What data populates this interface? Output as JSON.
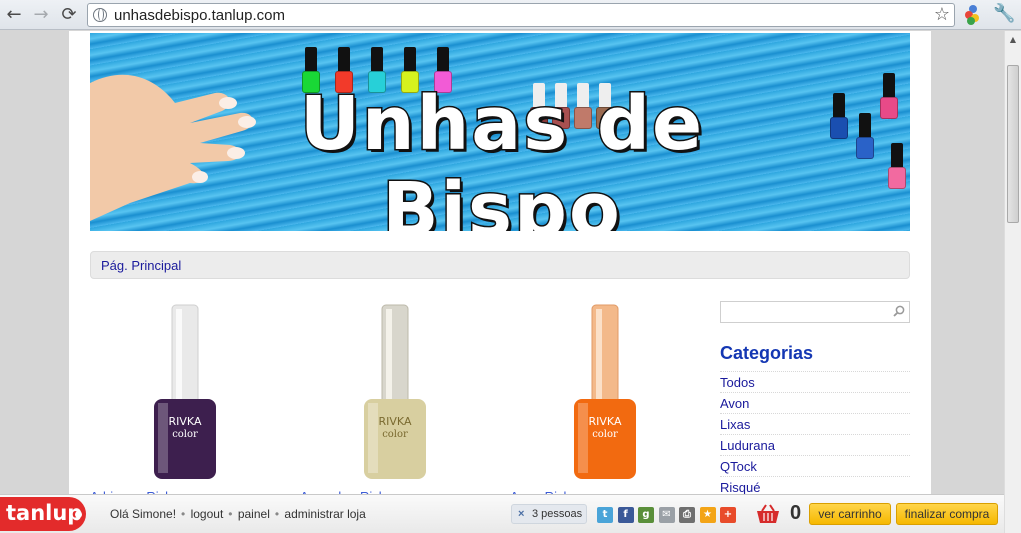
{
  "browser": {
    "url": "unhasdebispo.tanlup.com",
    "back_glyph": "←",
    "forward_glyph": "→",
    "reload_glyph": "⟳",
    "star_glyph": "☆",
    "wrench_glyph": "🔧"
  },
  "site": {
    "banner_title": "Unhas de Bispo",
    "nav": [
      "Pág. Principal"
    ]
  },
  "products": [
    {
      "name": "Adriana - Rivka",
      "color": "#3d1f4e",
      "icon": "nail-polish-bottle-icon"
    },
    {
      "name": "Amanda - Rivka",
      "color": "#d8cfa0",
      "icon": "nail-polish-bottle-icon"
    },
    {
      "name": "Ana - Rivka",
      "color": "#f26a10",
      "icon": "nail-polish-bottle-icon"
    }
  ],
  "sidebar": {
    "search_placeholder": "",
    "categories_title": "Categorias",
    "categories": [
      "Todos",
      "Avon",
      "Lixas",
      "Ludurana",
      "QTock",
      "Risqué"
    ]
  },
  "toolbar": {
    "logo": "tanlup",
    "greeting": "Olá Simone!",
    "links": [
      "logout",
      "painel",
      "administrar loja"
    ],
    "people_x": "×",
    "people": "3 pessoas",
    "cart_count": "0",
    "view_cart": "ver carrinho",
    "checkout": "finalizar compra",
    "share_icons": [
      {
        "name": "twitter-icon",
        "color": "#4aa4d8",
        "glyph": "t"
      },
      {
        "name": "facebook-icon",
        "color": "#3b5998",
        "glyph": "f"
      },
      {
        "name": "google-icon",
        "color": "#5a8f3a",
        "glyph": "g"
      },
      {
        "name": "email-icon",
        "color": "#9aa0a6",
        "glyph": "✉"
      },
      {
        "name": "print-icon",
        "color": "#6f6f6f",
        "glyph": "⎙"
      },
      {
        "name": "favorite-icon",
        "color": "#f3a416",
        "glyph": "★"
      },
      {
        "name": "more-share-icon",
        "color": "#e84b2a",
        "glyph": "+"
      }
    ]
  }
}
